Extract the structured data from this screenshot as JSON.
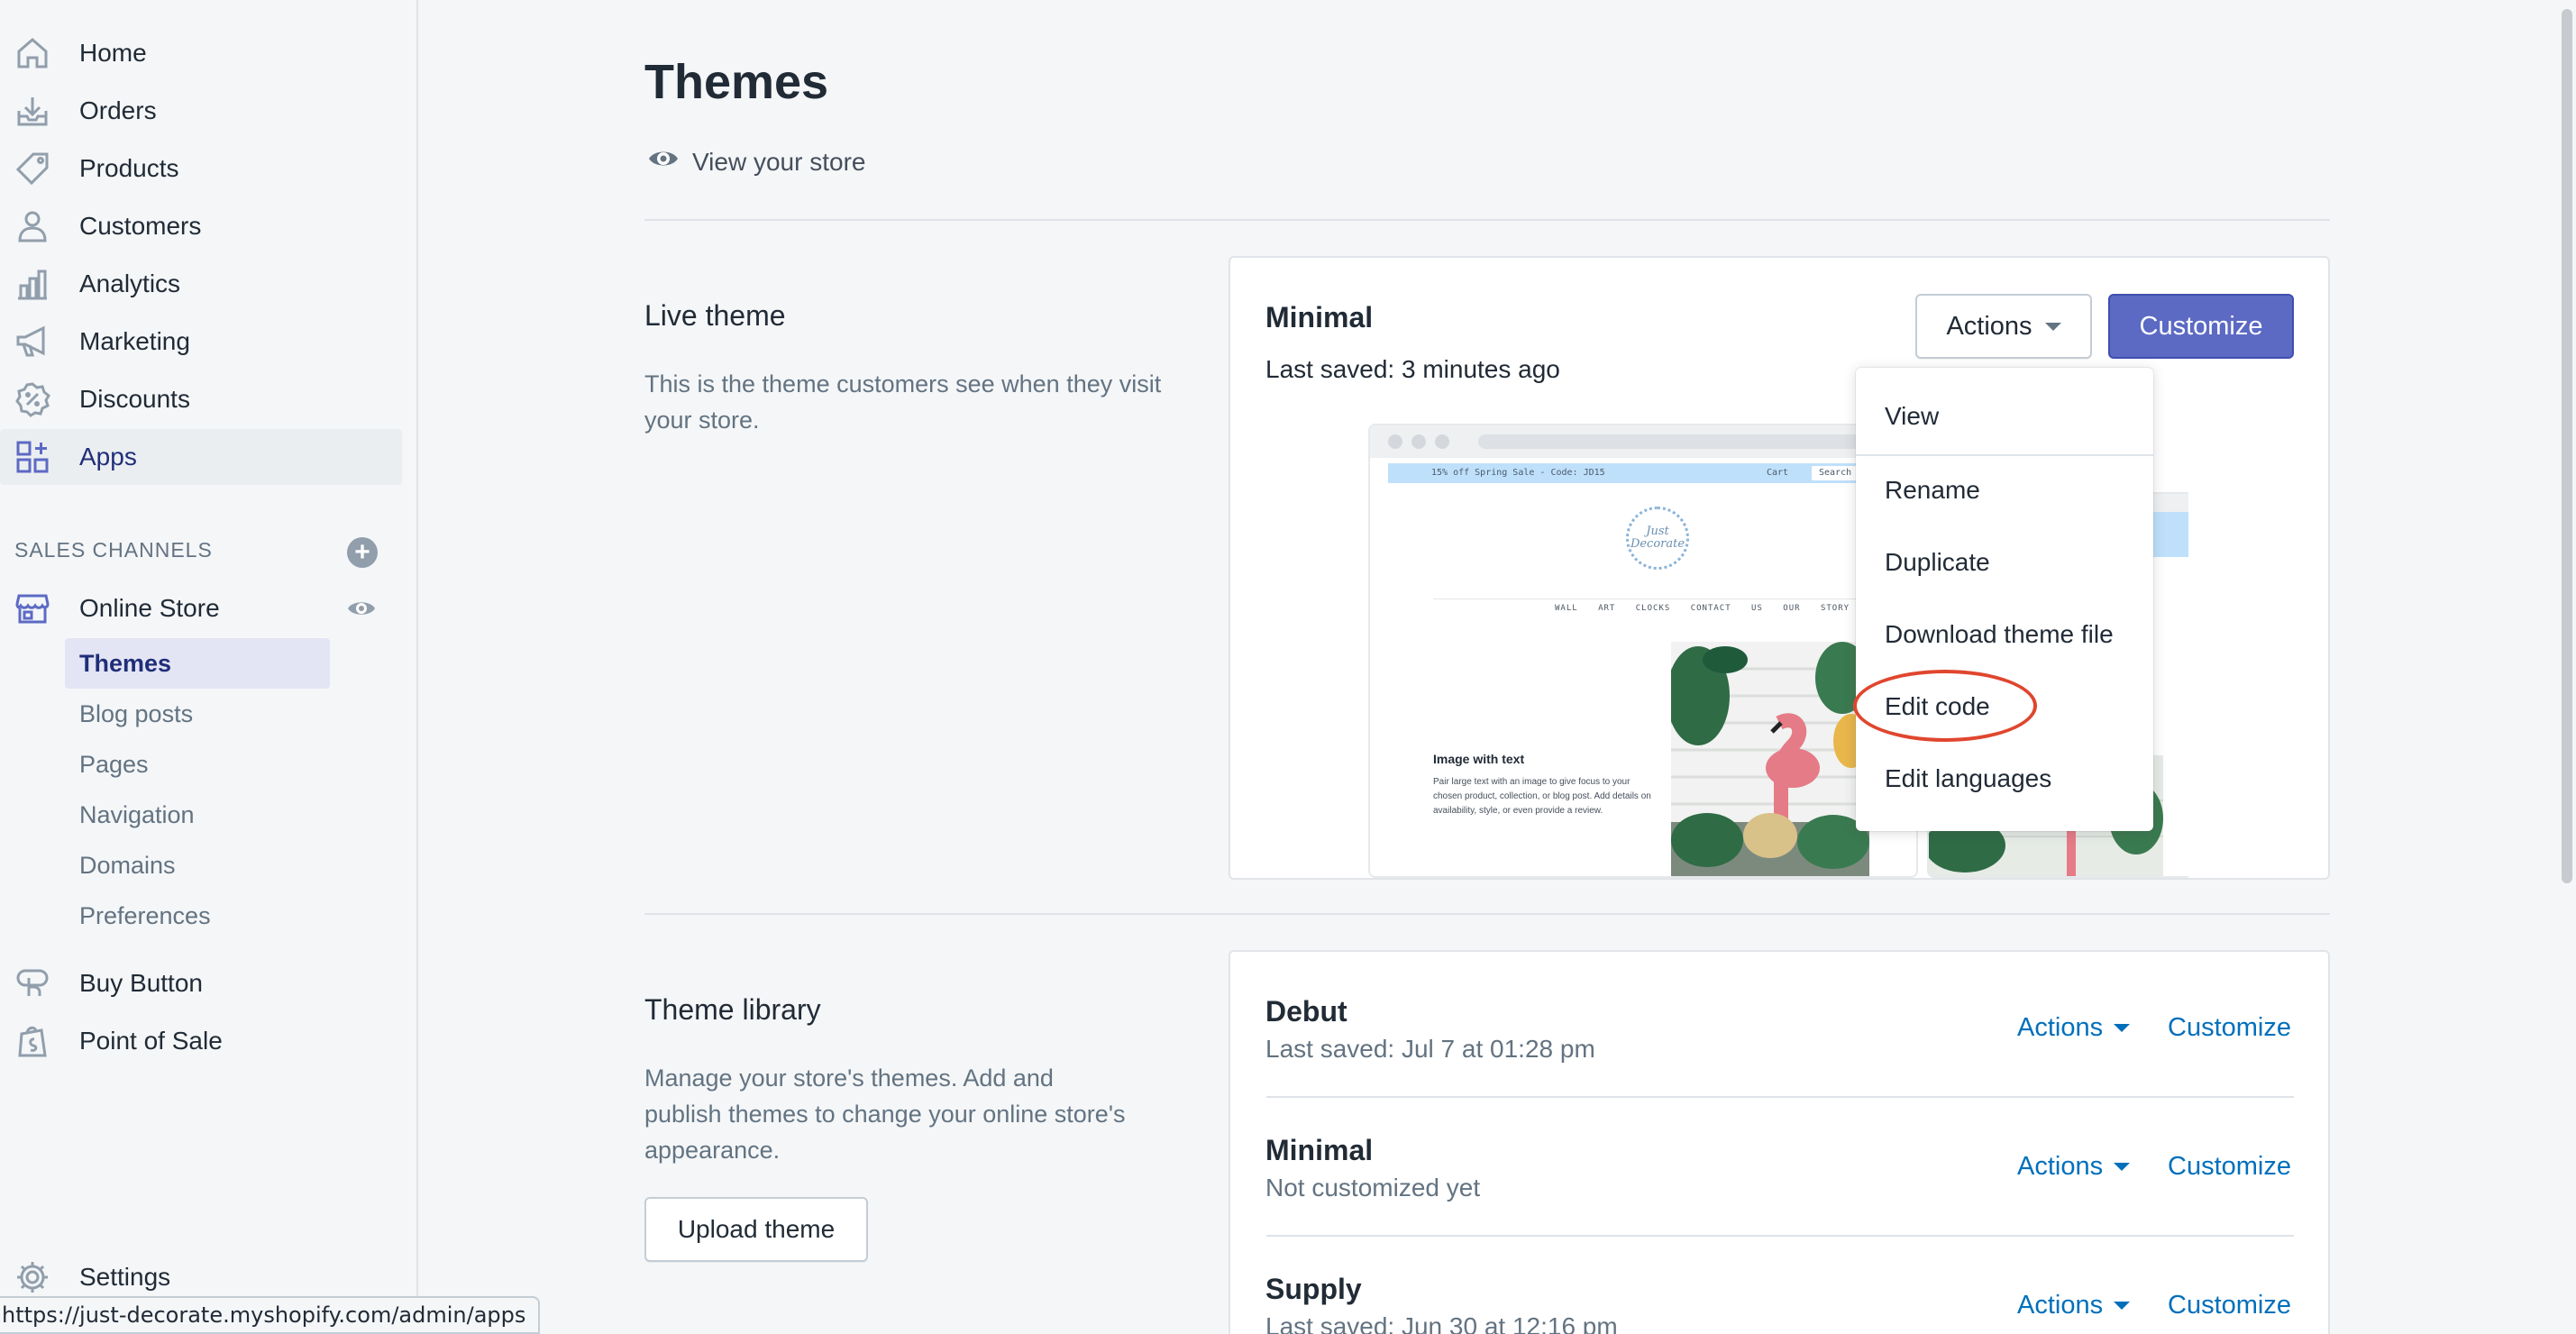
{
  "sidebar": {
    "items": [
      {
        "label": "Home",
        "icon": "home-icon"
      },
      {
        "label": "Orders",
        "icon": "orders-icon"
      },
      {
        "label": "Products",
        "icon": "tag-icon"
      },
      {
        "label": "Customers",
        "icon": "person-icon"
      },
      {
        "label": "Analytics",
        "icon": "bar-chart-icon"
      },
      {
        "label": "Marketing",
        "icon": "megaphone-icon"
      },
      {
        "label": "Discounts",
        "icon": "discount-icon"
      },
      {
        "label": "Apps",
        "icon": "apps-icon"
      }
    ],
    "sales_channels_header": "SALES CHANNELS",
    "online_store": "Online Store",
    "online_store_sub": [
      "Themes",
      "Blog posts",
      "Pages",
      "Navigation",
      "Domains",
      "Preferences"
    ],
    "buy_button": "Buy Button",
    "point_of_sale": "Point of Sale",
    "settings": "Settings"
  },
  "status_bar_url": "https://just-decorate.myshopify.com/admin/apps",
  "page": {
    "title": "Themes",
    "view_store": "View your store"
  },
  "live_theme": {
    "section_title": "Live theme",
    "description": "This is the theme customers see when they visit your store.",
    "name": "Minimal",
    "saved": "Last saved: 3 minutes ago",
    "actions_label": "Actions",
    "customize_label": "Customize"
  },
  "preview": {
    "announcement": "15% off Spring Sale - Code: JD15",
    "cart": "Cart",
    "search": "Search",
    "logo_text": "Just Decorate",
    "menu": "WALL ART   CLOCKS   CONTACT US   OUR STORY",
    "image_title": "Image with text",
    "image_body": "Pair large text with an image to give focus to your chosen product, collection, or blog post. Add details on availability, style, or even provide a review."
  },
  "actions_menu": {
    "items": [
      "View",
      "Rename",
      "Duplicate",
      "Download theme file",
      "Edit code",
      "Edit languages"
    ]
  },
  "library": {
    "section_title": "Theme library",
    "description": "Manage your store's themes. Add and publish themes to change your online store's appearance.",
    "upload_label": "Upload theme",
    "themes": [
      {
        "name": "Debut",
        "saved": "Last saved: Jul 7 at 01:28 pm",
        "actions": "Actions",
        "customize": "Customize"
      },
      {
        "name": "Minimal",
        "saved": "Not customized yet",
        "actions": "Actions",
        "customize": "Customize"
      },
      {
        "name": "Supply",
        "saved": "Last saved: Jun 30 at 12:16 pm",
        "actions": "Actions",
        "customize": "Customize"
      }
    ]
  },
  "colors": {
    "accent": "#5c6ac4",
    "link": "#006fbb",
    "highlight": "#e0462e"
  }
}
